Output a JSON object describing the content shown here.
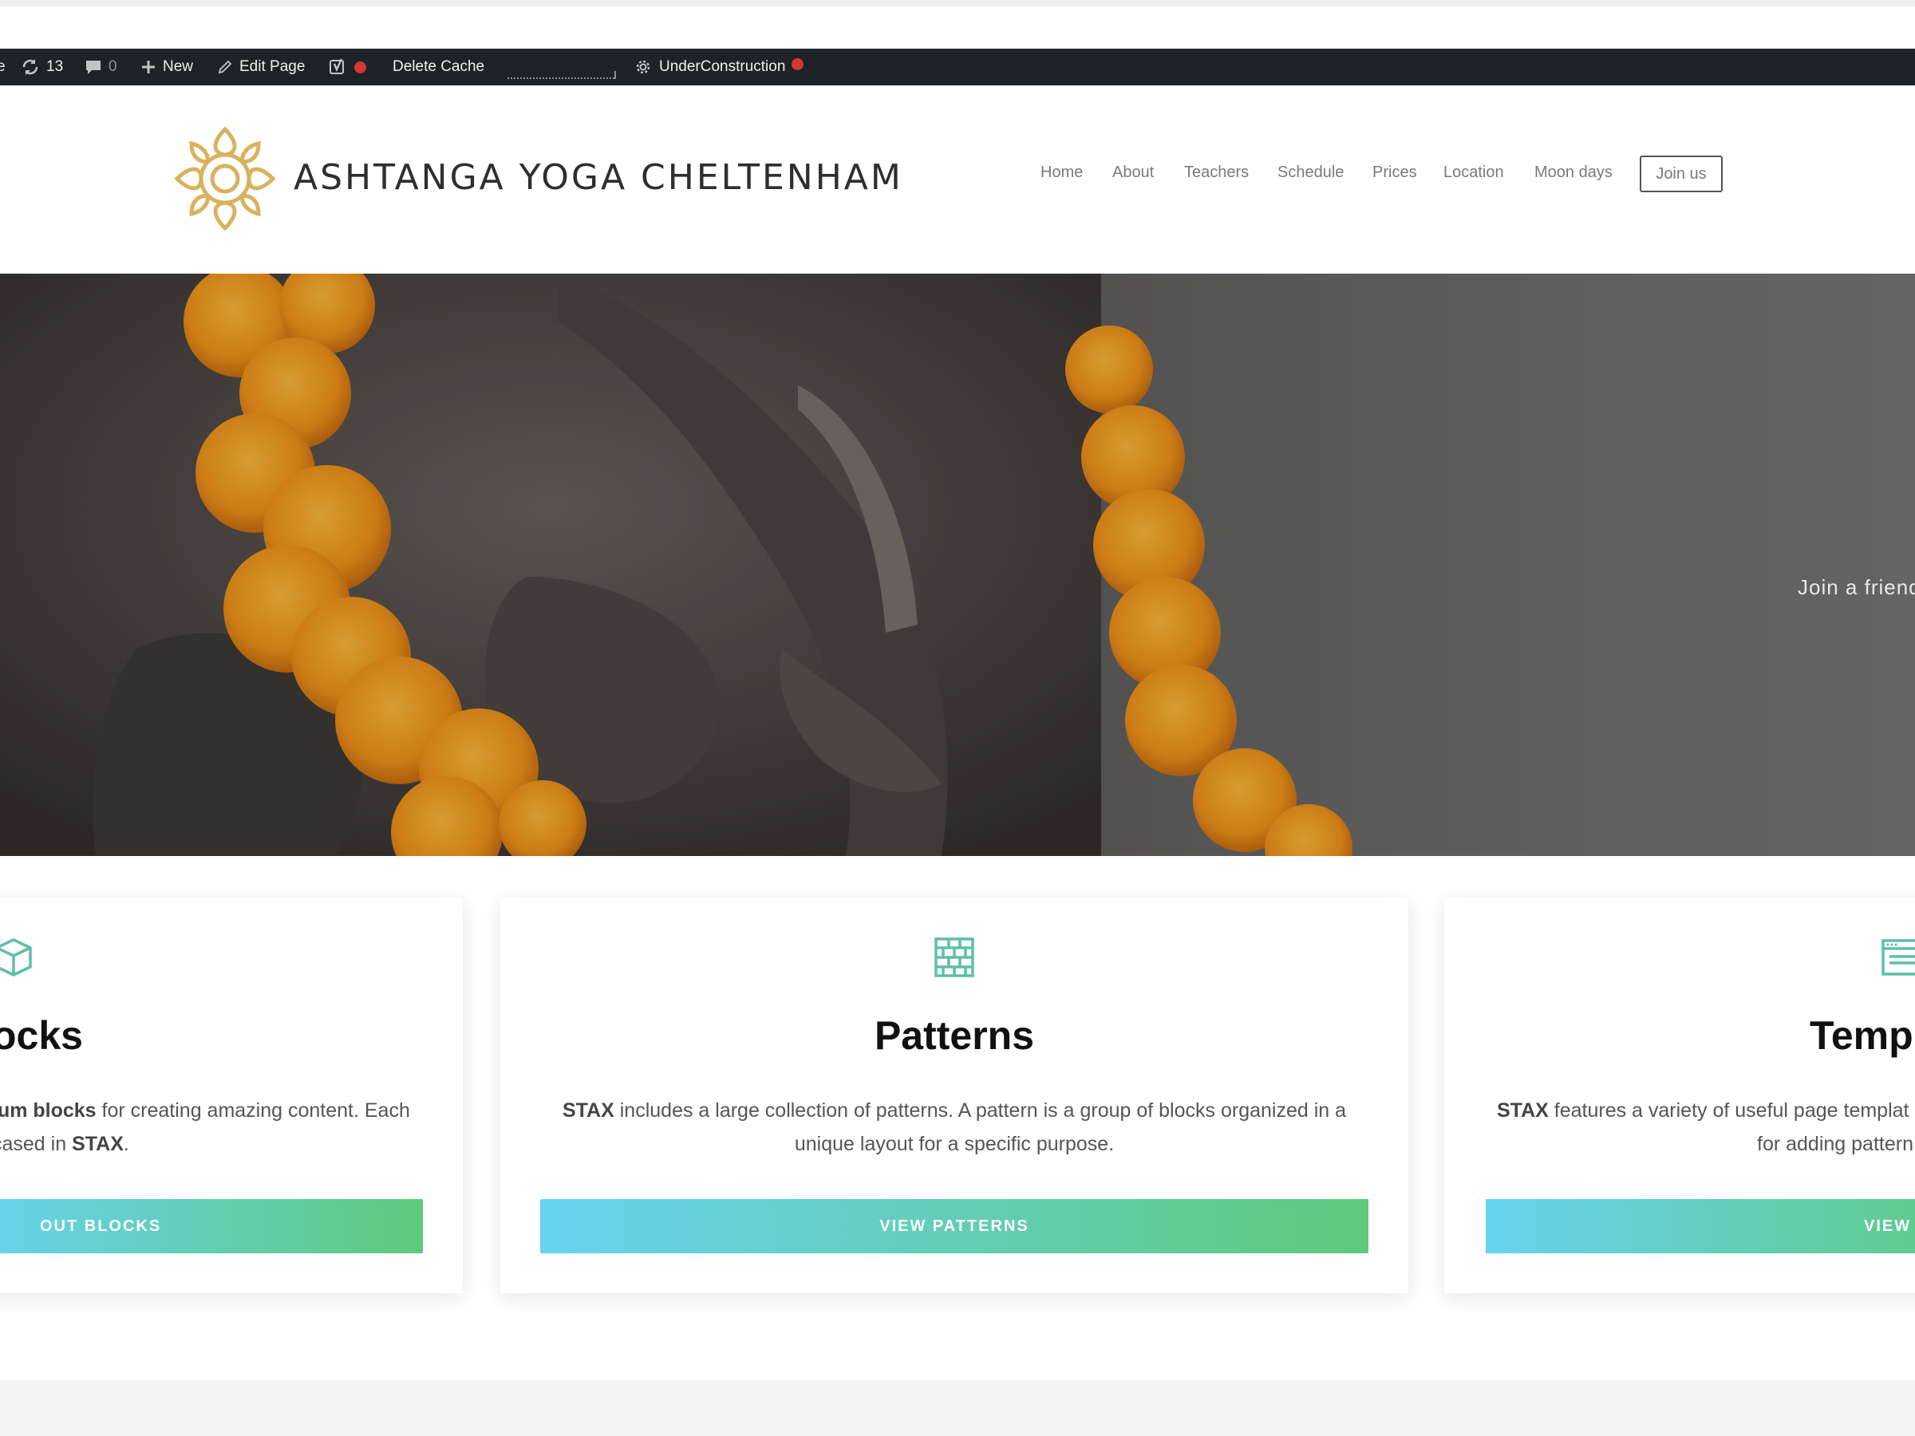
{
  "admin_bar": {
    "updates_count": "13",
    "comments_count": "0",
    "new_label": "New",
    "edit_page_label": "Edit Page",
    "delete_cache_label": "Delete Cache",
    "under_construction_label": "UnderConstruction"
  },
  "site": {
    "title": "ASHTANGA YOGA CHELTENHAM"
  },
  "nav": {
    "items": [
      "Home",
      "About",
      "Teachers",
      "Schedule",
      "Prices",
      "Location",
      "Moon days"
    ],
    "cta": "Join us"
  },
  "hero": {
    "text": "Join a friend"
  },
  "cards": [
    {
      "title": "ocks",
      "desc_bold_1": "ium blocks",
      "desc_text_1": " for creating amazing content. Each",
      "desc_text_2": "cased in ",
      "desc_bold_2": "STAX",
      "desc_text_3": ".",
      "button": "OUT BLOCKS",
      "icon": "cube-icon"
    },
    {
      "title": "Patterns",
      "desc_bold_1": "STAX",
      "desc_text_1": " includes a large collection of patterns. A pattern is a group of blocks organized in a unique layout for a specific purpose.",
      "button": "VIEW PATTERNS",
      "icon": "brick-pattern-icon"
    },
    {
      "title": "Templ",
      "desc_bold_1": "STAX",
      "desc_text_1": " features a variety of useful page templat",
      "desc_text_2": "for adding pattern",
      "button": "VIEW TEMP",
      "icon": "template-window-icon"
    }
  ],
  "colors": {
    "admin_bar_bg": "#1d2327",
    "accent_teal": "#5ebfa8",
    "button_gradient_start": "#66d3f0",
    "button_gradient_end": "#5fc97c",
    "logo_gold": "#d9b25e",
    "status_red": "#d63638"
  }
}
